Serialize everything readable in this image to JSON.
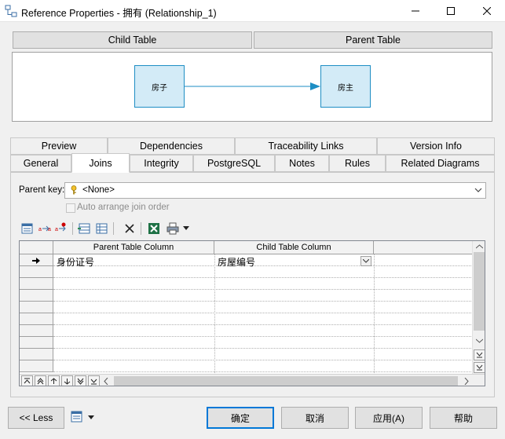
{
  "window": {
    "title": "Reference Properties - 拥有 (Relationship_1)",
    "controls": {
      "minimize": "—",
      "maximize": "☐",
      "close": "✕"
    }
  },
  "header": {
    "child_table": "Child Table",
    "parent_table": "Parent Table"
  },
  "diagram": {
    "child_box": "房子",
    "parent_box": "房主"
  },
  "tabs_back": [
    "Preview",
    "Dependencies",
    "Traceability Links",
    "Version Info"
  ],
  "tabs_front": [
    "General",
    "Joins",
    "Integrity",
    "PostgreSQL",
    "Notes",
    "Rules",
    "Related Diagrams"
  ],
  "active_tab": "Joins",
  "joins": {
    "parent_key_label": "Parent key:",
    "parent_key_value": "<None>",
    "auto_arrange_label": "Auto arrange join order",
    "auto_arrange_checked": false,
    "columns": [
      "Parent Table Column",
      "Child Table Column"
    ],
    "rows": [
      {
        "parent": "身份证号",
        "child": "房屋编号"
      }
    ]
  },
  "bottom": {
    "less": "<< Less",
    "ok": "确定",
    "cancel": "取消",
    "apply": "应用(A)",
    "help": "帮助"
  },
  "colors": {
    "table_fill": "#d3ebf7",
    "table_border": "#1e8ec4",
    "accent": "#0078d7"
  }
}
